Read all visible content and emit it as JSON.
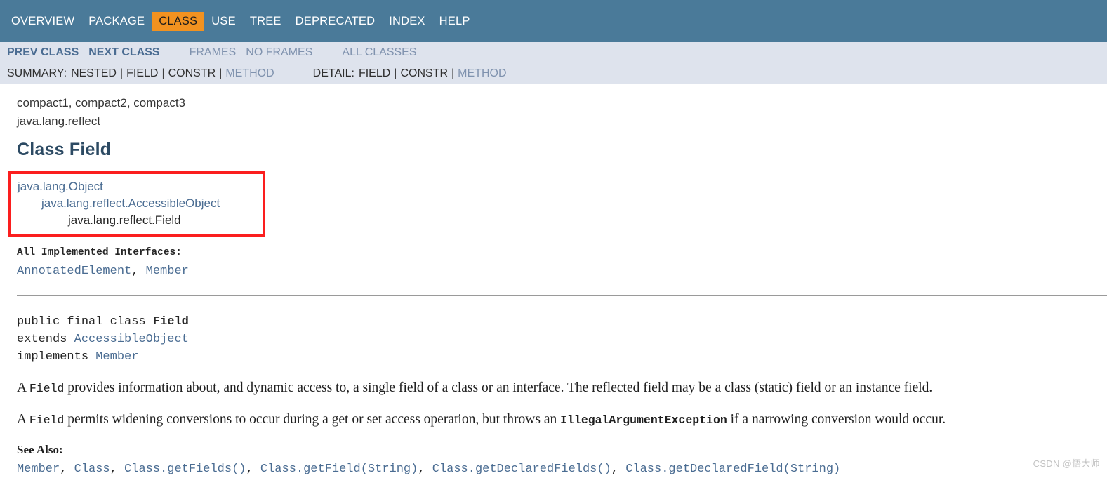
{
  "colors": {
    "nav_bar_bg": "#4A7A99",
    "active_tab_bg": "#F29220",
    "sub_nav_bg": "#DEE3ED",
    "link_blue": "#4A6C92",
    "title_blue": "#2C4A63",
    "highlight_border_red": "#FB1E1E"
  },
  "top_nav": {
    "items": [
      {
        "label": "OVERVIEW",
        "active": false
      },
      {
        "label": "PACKAGE",
        "active": false
      },
      {
        "label": "CLASS",
        "active": true
      },
      {
        "label": "USE",
        "active": false
      },
      {
        "label": "TREE",
        "active": false
      },
      {
        "label": "DEPRECATED",
        "active": false
      },
      {
        "label": "INDEX",
        "active": false
      },
      {
        "label": "HELP",
        "active": false
      }
    ]
  },
  "sub_nav": {
    "prev_class": "PREV CLASS",
    "next_class": "NEXT CLASS",
    "frames": "FRAMES",
    "no_frames": "NO FRAMES",
    "all_classes": "ALL CLASSES",
    "summary_label": "SUMMARY:",
    "summary_items": [
      "NESTED",
      "FIELD",
      "CONSTR",
      "METHOD"
    ],
    "summary_nested": "NESTED",
    "summary_field": "FIELD",
    "summary_constr": "CONSTR",
    "summary_method": "METHOD",
    "detail_label": "DETAIL:",
    "detail_field": "FIELD",
    "detail_constr": "CONSTR",
    "detail_method": "METHOD",
    "separator": "|"
  },
  "header": {
    "profiles": "compact1, compact2, compact3",
    "package": "java.lang.reflect",
    "title": "Class Field"
  },
  "inheritance": {
    "lines": [
      {
        "text": "java.lang.Object",
        "indent": 0,
        "current": false
      },
      {
        "text": "java.lang.reflect.AccessibleObject",
        "indent": 1,
        "current": false
      },
      {
        "text": "java.lang.reflect.Field",
        "indent": 2,
        "current": true
      }
    ],
    "line0": "java.lang.Object",
    "line1": "java.lang.reflect.AccessibleObject",
    "line2": "java.lang.reflect.Field"
  },
  "interfaces": {
    "label": "All Implemented Interfaces:",
    "items": [
      "AnnotatedElement",
      "Member"
    ],
    "item0": "AnnotatedElement",
    "item1": "Member",
    "comma": ", "
  },
  "declaration": {
    "line1_keywords": "public final class ",
    "line1_name": "Field",
    "line2_keyword": "extends ",
    "line2_type": "AccessibleObject",
    "line3_keyword": "implements ",
    "line3_type": "Member"
  },
  "description": {
    "p1_a": "A ",
    "p1_code": "Field",
    "p1_b": " provides information about, and dynamic access to, a single field of a class or an interface. The reflected field may be a class (static) field or an instance field.",
    "p2_a": "A ",
    "p2_code": "Field",
    "p2_b": " permits widening conversions to occur during a get or set access operation, but throws an ",
    "p2_code2": "IllegalArgumentException",
    "p2_c": " if a narrowing conversion would occur."
  },
  "see_also": {
    "label": "See Also:",
    "items": [
      "Member",
      "Class",
      "Class.getFields()",
      "Class.getField(String)",
      "Class.getDeclaredFields()",
      "Class.getDeclaredField(String)"
    ],
    "item0": "Member",
    "item1": "Class",
    "item2": "Class.getFields()",
    "item3": "Class.getField(String)",
    "item4": "Class.getDeclaredFields()",
    "item5": "Class.getDeclaredField(String)",
    "comma": ", "
  },
  "watermark": {
    "text": "CSDN @悟大师"
  }
}
